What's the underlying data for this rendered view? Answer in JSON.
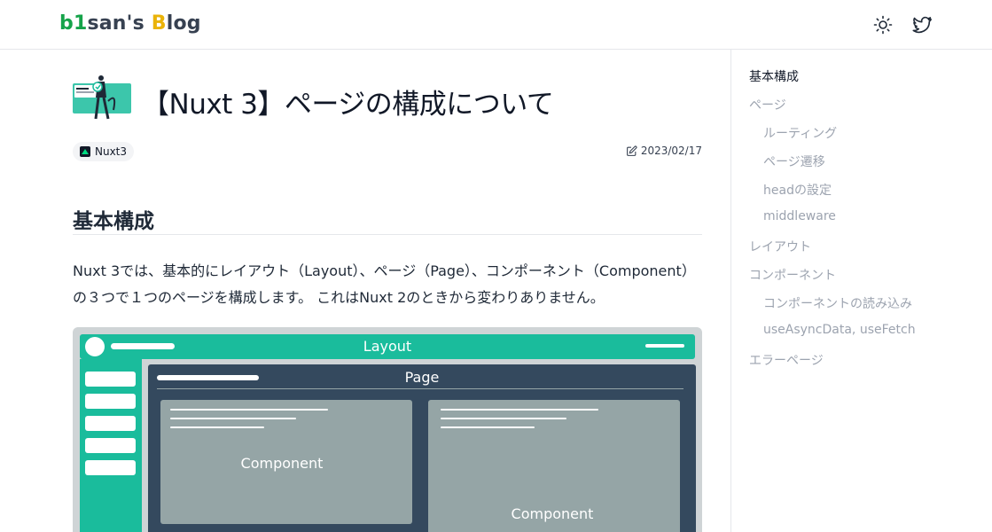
{
  "header": {
    "logo": {
      "part1": "b",
      "part2": "1",
      "part3": "san's ",
      "part4": "B",
      "part5": "log"
    },
    "icons": [
      "sun-icon",
      "twitter-icon"
    ]
  },
  "article": {
    "title": "【Nuxt 3】ページの構成について",
    "tag": "Nuxt3",
    "date": "2023/02/17",
    "section_heading": "基本構成",
    "paragraph": "Nuxt 3では、基本的にレイアウト（Layout）、ページ（Page）、コンポーネント（Component）の３つで１つのページを構成します。 これはNuxt 2のときから変わりありません。"
  },
  "diagram": {
    "layout_label": "Layout",
    "page_label": "Page",
    "component_left": "Component",
    "component_right": "Component"
  },
  "toc": [
    {
      "label": "基本構成",
      "level": 1,
      "active": true
    },
    {
      "label": "ページ",
      "level": 1,
      "active": false
    },
    {
      "label": "ルーティング",
      "level": 2,
      "active": false
    },
    {
      "label": "ページ遷移",
      "level": 2,
      "active": false
    },
    {
      "label": "headの設定",
      "level": 2,
      "active": false
    },
    {
      "label": "middleware",
      "level": 2,
      "active": false
    },
    {
      "label": "レイアウト",
      "level": 1,
      "active": false
    },
    {
      "label": "コンポーネント",
      "level": 1,
      "active": false
    },
    {
      "label": "コンポーネントの読み込み",
      "level": 2,
      "active": false
    },
    {
      "label": "useAsyncData, useFetch",
      "level": 2,
      "active": false
    },
    {
      "label": "エラーページ",
      "level": 1,
      "active": false
    }
  ],
  "colors": {
    "logo_green": "#16a34a",
    "logo_yellow": "#eab308",
    "layout_teal": "#1abc9c",
    "page_navy": "#34495e",
    "component_gray": "#95a5a6"
  }
}
